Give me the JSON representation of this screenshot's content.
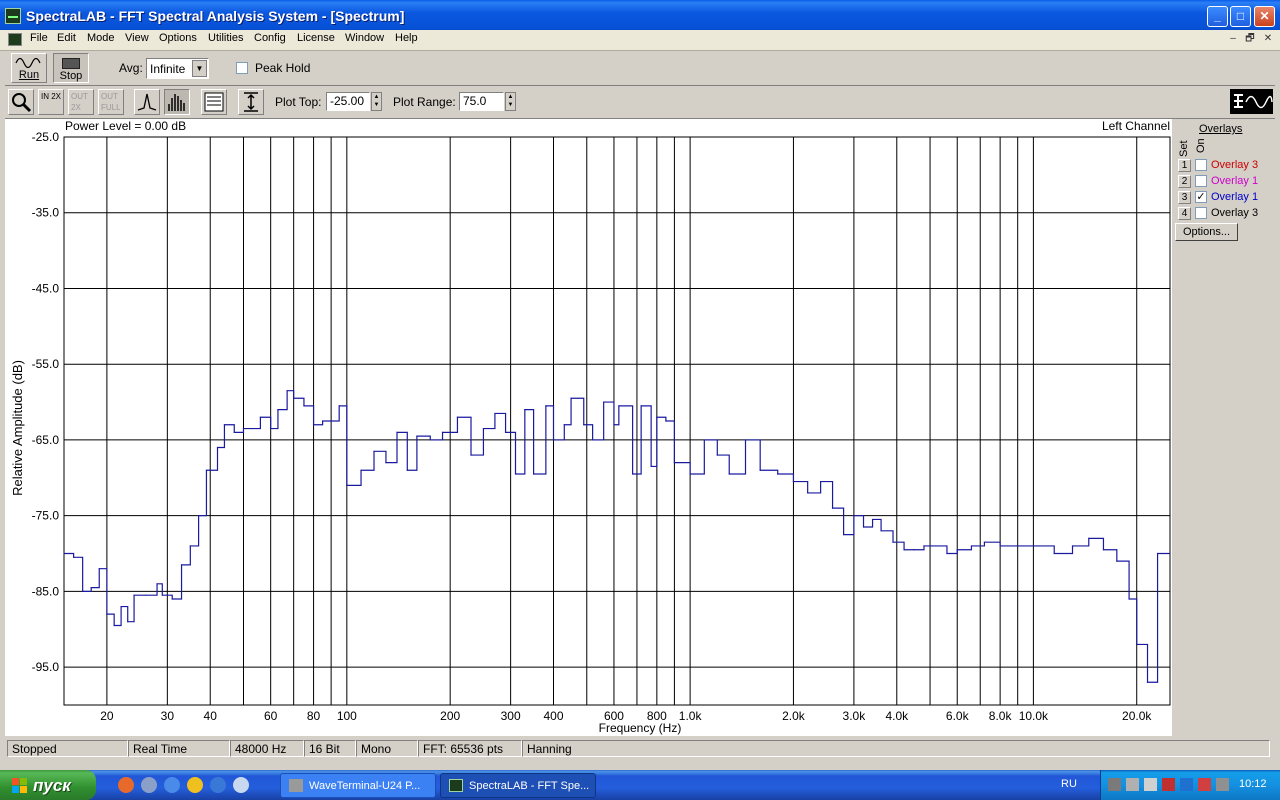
{
  "window": {
    "title": "SpectraLAB - FFT Spectral Analysis System - [Spectrum]",
    "min_glyph": "_",
    "max_glyph": "□",
    "close_glyph": "✕"
  },
  "menu": [
    "File",
    "Edit",
    "Mode",
    "View",
    "Options",
    "Utilities",
    "Config",
    "License",
    "Window",
    "Help"
  ],
  "mdi_controls": [
    "–",
    "🗗",
    "✕"
  ],
  "toolbar": {
    "run_label": "Run",
    "stop_label": "Stop",
    "avg_label": "Avg:",
    "avg_value": "Infinite",
    "peak_hold_label": "Peak Hold",
    "peak_hold_checked": false,
    "zoom_buttons": [
      "IN 2X",
      "OUT 2X",
      "OUT FULL"
    ],
    "plot_top_label": "Plot Top:",
    "plot_top_value": "-25.00",
    "plot_range_label": "Plot Range:",
    "plot_range_value": "75.0"
  },
  "chart_header": {
    "power_level": "Power Level = 0.00 dB",
    "channel": "Left Channel"
  },
  "chart_data": {
    "type": "line",
    "ylabel": "Relative Amplitude (dB)",
    "xlabel": "Frequency (Hz)",
    "x_scale": "log",
    "xlim": [
      15,
      25000
    ],
    "ylim": [
      -100,
      -25
    ],
    "y_ticks": [
      -25,
      -35,
      -45,
      -55,
      -65,
      -75,
      -85,
      -95
    ],
    "y_tick_labels": [
      "-25.0",
      "-35.0",
      "-45.0",
      "-55.0",
      "-65.0",
      "-75.0",
      "-85.0",
      "-95.0"
    ],
    "x_ticks": [
      20,
      30,
      40,
      60,
      80,
      100,
      200,
      300,
      400,
      600,
      800,
      1000,
      2000,
      3000,
      4000,
      6000,
      8000,
      10000,
      20000
    ],
    "x_tick_labels": [
      "20",
      "30",
      "40",
      "60",
      "80",
      "100",
      "200",
      "300",
      "400",
      "600",
      "800",
      "1.0k",
      "2.0k",
      "3.0k",
      "4.0k",
      "6.0k",
      "8.0k",
      "10.0k",
      "20.0k"
    ],
    "x_grid": [
      20,
      30,
      40,
      50,
      60,
      70,
      80,
      90,
      100,
      200,
      300,
      400,
      500,
      600,
      700,
      800,
      900,
      1000,
      2000,
      3000,
      4000,
      5000,
      6000,
      7000,
      8000,
      9000,
      10000,
      20000
    ],
    "grid": true,
    "series_color": "#1a1aa0",
    "series": [
      {
        "points": [
          [
            15,
            -80
          ],
          [
            16,
            -80.5
          ],
          [
            17,
            -85
          ],
          [
            18,
            -84.5
          ],
          [
            19,
            -82
          ],
          [
            20,
            -88
          ],
          [
            21,
            -89.5
          ],
          [
            22,
            -87
          ],
          [
            23,
            -89
          ],
          [
            24,
            -85.5
          ],
          [
            26,
            -85.5
          ],
          [
            28,
            -84
          ],
          [
            29,
            -85.5
          ],
          [
            31,
            -86
          ],
          [
            33,
            -81.5
          ],
          [
            35,
            -79
          ],
          [
            37,
            -75
          ],
          [
            39,
            -69
          ],
          [
            42,
            -66
          ],
          [
            44,
            -63
          ],
          [
            47,
            -64
          ],
          [
            50,
            -63.5
          ],
          [
            53,
            -63.5
          ],
          [
            56,
            -62
          ],
          [
            60,
            -63.5
          ],
          [
            63,
            -61
          ],
          [
            67,
            -58.5
          ],
          [
            70,
            -59.5
          ],
          [
            75,
            -60.5
          ],
          [
            80,
            -63
          ],
          [
            85,
            -62.5
          ],
          [
            90,
            -62.5
          ],
          [
            95,
            -60.5
          ],
          [
            100,
            -71
          ],
          [
            110,
            -69
          ],
          [
            120,
            -66.5
          ],
          [
            130,
            -68
          ],
          [
            140,
            -64
          ],
          [
            150,
            -69
          ],
          [
            160,
            -64.5
          ],
          [
            175,
            -65
          ],
          [
            190,
            -64
          ],
          [
            210,
            -62
          ],
          [
            230,
            -67
          ],
          [
            250,
            -63.5
          ],
          [
            270,
            -61.5
          ],
          [
            290,
            -64
          ],
          [
            310,
            -69.5
          ],
          [
            330,
            -61
          ],
          [
            350,
            -69.5
          ],
          [
            380,
            -60.5
          ],
          [
            400,
            -65
          ],
          [
            430,
            -63
          ],
          [
            450,
            -59.5
          ],
          [
            490,
            -63
          ],
          [
            520,
            -65
          ],
          [
            560,
            -60
          ],
          [
            600,
            -63
          ],
          [
            620,
            -60.5
          ],
          [
            680,
            -69.5
          ],
          [
            720,
            -60.5
          ],
          [
            770,
            -68.5
          ],
          [
            800,
            -62
          ],
          [
            850,
            -62.5
          ],
          [
            900,
            -68
          ],
          [
            1000,
            -69.5
          ],
          [
            1100,
            -65
          ],
          [
            1200,
            -67
          ],
          [
            1300,
            -69.5
          ],
          [
            1450,
            -65
          ],
          [
            1600,
            -69
          ],
          [
            1800,
            -69.5
          ],
          [
            2000,
            -70.5
          ],
          [
            2200,
            -72
          ],
          [
            2400,
            -70.5
          ],
          [
            2600,
            -74
          ],
          [
            2800,
            -77.5
          ],
          [
            3000,
            -75
          ],
          [
            3200,
            -76.5
          ],
          [
            3400,
            -75.5
          ],
          [
            3600,
            -77
          ],
          [
            3900,
            -78.5
          ],
          [
            4200,
            -79.5
          ],
          [
            4500,
            -79.5
          ],
          [
            4800,
            -79
          ],
          [
            5200,
            -79
          ],
          [
            5600,
            -80
          ],
          [
            6000,
            -79.5
          ],
          [
            6600,
            -79
          ],
          [
            7200,
            -78.5
          ],
          [
            8000,
            -79
          ],
          [
            9000,
            -79
          ],
          [
            10000,
            -79
          ],
          [
            11500,
            -80
          ],
          [
            13000,
            -79
          ],
          [
            14500,
            -78
          ],
          [
            16000,
            -79.5
          ],
          [
            17500,
            -81
          ],
          [
            19000,
            -86
          ],
          [
            20000,
            -92
          ],
          [
            21500,
            -97
          ],
          [
            23000,
            -80
          ]
        ]
      }
    ]
  },
  "overlays": {
    "title": "Overlays",
    "col_set": "Set",
    "col_on": "On",
    "rows": [
      {
        "num": "1",
        "checked": false,
        "name": "Overlay 3",
        "color": "#cc0000"
      },
      {
        "num": "2",
        "checked": false,
        "name": "Overlay 1",
        "color": "#cc00cc"
      },
      {
        "num": "3",
        "checked": true,
        "name": "Overlay 1",
        "color": "#0000cc"
      },
      {
        "num": "4",
        "checked": false,
        "name": "Overlay 3",
        "color": "#000000"
      }
    ],
    "options_label": "Options..."
  },
  "status": [
    "Stopped",
    "Real Time",
    "48000 Hz",
    "16 Bit",
    "Mono",
    "FFT: 65536 pts",
    "Hanning"
  ],
  "taskbar": {
    "start_label": "пуск",
    "tasks": [
      "WaveTerminal-U24 P...",
      "SpectraLAB - FFT Spe..."
    ],
    "lang": "RU",
    "clock": "10:12"
  }
}
